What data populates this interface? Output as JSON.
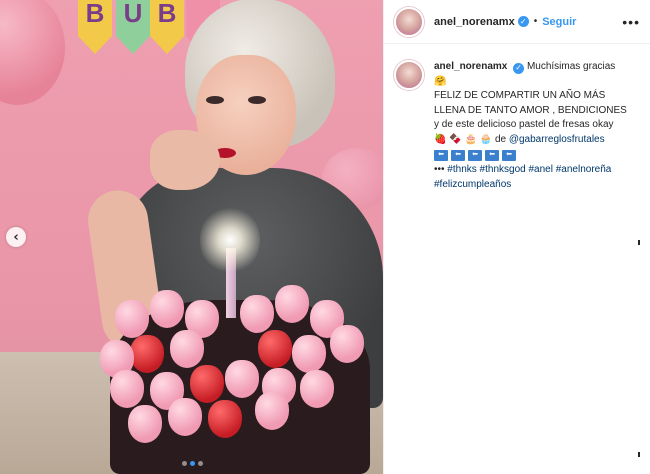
{
  "media": {
    "nav_prev_icon": "chevron-left-icon",
    "nav_prev_glyph": "‹",
    "banner_letters": [
      "B",
      "U",
      "B",
      ""
    ],
    "carousel": {
      "count": 3,
      "active_index": 1
    }
  },
  "header": {
    "username": "anel_norenamx",
    "verified_glyph": "✓",
    "separator": "•",
    "follow_label": "Seguir",
    "more_glyph": "•••"
  },
  "caption": {
    "username": "anel_norenamx",
    "verified_glyph": "✓",
    "first_text": "Muchísimas gracias",
    "hug_emoji": "🤗",
    "line2": "FELIZ DE COMPARTIR UN AÑO MÁS",
    "line3": "LLENA DE TANTO AMOR , BENDICIONES",
    "line4": "y de este delicioso pastel de fresas okay",
    "emoji_row": [
      "🍓",
      "🍫",
      "🎂",
      "🧁"
    ],
    "de_text": "de",
    "mention": "@gabarreglosfrutales",
    "arrow_boxes": [
      "⬅",
      "⬅",
      "⬅",
      "⬅",
      "⬅"
    ],
    "hashtags_line1_prefix": "•••",
    "hashtags_line1": [
      "#thnks",
      "#thnksgod",
      "#anel",
      "#anelnoreña"
    ],
    "hashtags_line2": [
      "#felizcumpleaños"
    ]
  },
  "colors": {
    "link_blue": "#3897f0",
    "hashtag": "#00376b",
    "text": "#262626"
  }
}
